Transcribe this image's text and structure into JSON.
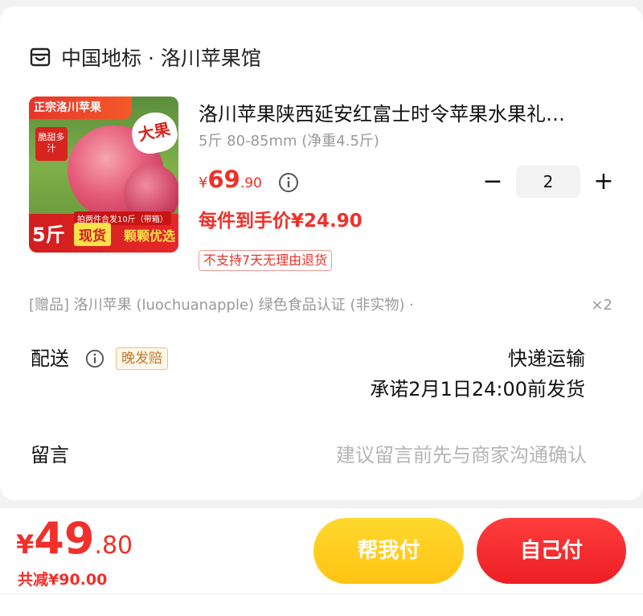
{
  "shop": {
    "name": "中国地标 · 洛川苹果馆",
    "icon": "store-icon"
  },
  "product": {
    "title": "洛川苹果陕西延安红富士时令苹果水果礼…",
    "spec": "5斤 80-85mm (净重4.5斤)",
    "price_yen": "¥",
    "price_int": "69",
    "price_dec": ".90",
    "final_price": "每件到手价¥24.90",
    "return_tag": "不支持7天无理由退货",
    "quantity": "2",
    "minus": "−",
    "plus": "+",
    "image": {
      "tag_top": "正宗洛川苹果",
      "tag_sweet": "脆甜多汁",
      "tag_big": "大果",
      "strip_note": "拍两件合发10斤（带箱）",
      "weight": "5斤",
      "stock": "现货",
      "pick": "颗颗优选"
    }
  },
  "gift": {
    "text": "[赠品] 洛川苹果 (luochuanapple) 绿色食品认证 (非实物) ·",
    "count": "×2"
  },
  "delivery": {
    "label": "配送",
    "late_badge": "晚发赔",
    "method": "快递运输",
    "promise": "承诺2月1日24:00前发货"
  },
  "message": {
    "label": "留言",
    "placeholder": "建议留言前先与商家沟通确认"
  },
  "footer": {
    "total_yen": "¥",
    "total_int": "49",
    "total_dec": ".80",
    "discount": "共减¥90.00",
    "help_pay": "帮我付",
    "self_pay": "自己付"
  },
  "colors": {
    "accent_red": "#f0302a",
    "help_yellow": "#ffc414",
    "self_red": "#ec1f24"
  }
}
